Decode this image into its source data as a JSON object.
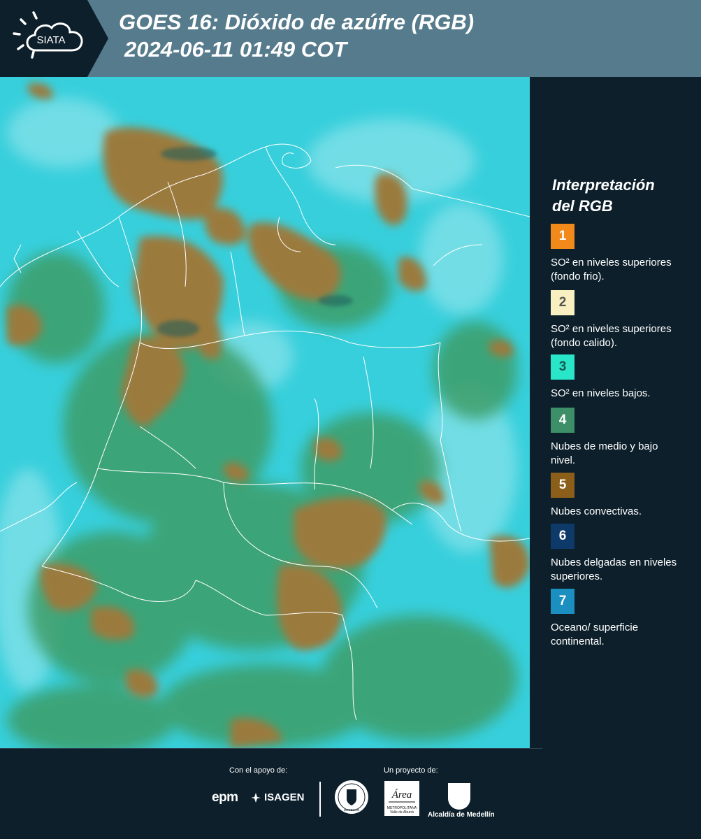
{
  "header": {
    "logo_text": "SIATA",
    "title": "GOES 16: Dióxido de azúfre (RGB)",
    "timestamp": "2024-06-11 01:49 COT",
    "background_color": "#557b8c",
    "logo_background_color": "#0c1f2b"
  },
  "map": {
    "background_color": "#37cfdc",
    "convective_color": "#9b7a3c",
    "low_cloud_color": "#3c9d68",
    "border_color": "#ffffff"
  },
  "legend": {
    "title_line1": "Interpretación",
    "title_line2": "del RGB",
    "items": [
      {
        "number": "1",
        "label": "SO² en niveles superiores (fondo frio).",
        "color": "#f28a1b",
        "number_color": "#ffffff"
      },
      {
        "number": "2",
        "label": "SO² en niveles superiores (fondo calido).",
        "color": "#f8f0c0",
        "number_color": "#555555"
      },
      {
        "number": "3",
        "label": "SO² en niveles bajos.",
        "color": "#29e6c9",
        "number_color": "#1a5a55"
      },
      {
        "number": "4",
        "label": "Nubes de medio y bajo nivel.",
        "color": "#3c8f67",
        "number_color": "#ffffff"
      },
      {
        "number": "5",
        "label": "Nubes convectivas.",
        "color": "#8b5e1a",
        "number_color": "#ffffff"
      },
      {
        "number": "6",
        "label": "Nubes delgadas en niveles superiores.",
        "color": "#0e3a6a",
        "number_color": "#ffffff"
      },
      {
        "number": "7",
        "label": "Oceano/ superficie continental.",
        "color": "#1a8fc0",
        "number_color": "#ffffff"
      }
    ]
  },
  "footer": {
    "support_label": "Con el apoyo de:",
    "project_label": "Un proyecto de:",
    "epm_logo_text": "epm",
    "isagen_logo_text": "ISAGEN",
    "seal_text": "MEDELLÍN",
    "amva_logo_text": "Área",
    "amva_sub_text": "METROPOLITANA Valle de Aburrá",
    "alcaldia_label": "Alcaldía de Medellín"
  }
}
